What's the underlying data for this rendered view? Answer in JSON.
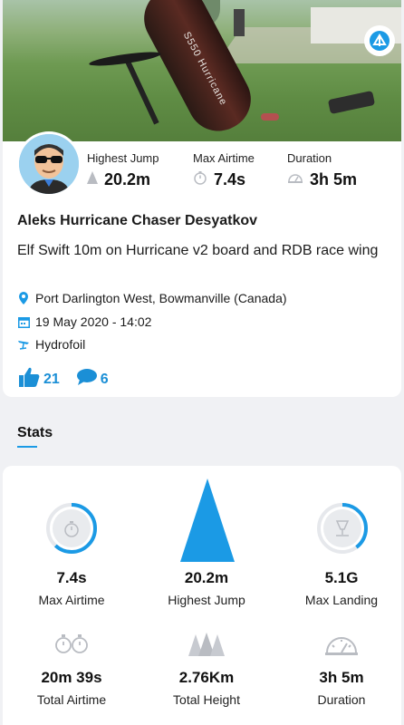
{
  "activity": {
    "rider_name": "Aleks Hurricane Chaser Desyatkov",
    "description": "Elf Swift 10m on Hurricane v2 board and RDB race wing",
    "location": "Port Darlington West, Bowmanville (Canada)",
    "datetime": "19 May 2020 - 14:02",
    "sport": "Hydrofoil",
    "likes": "21",
    "comments": "6",
    "board_print": "S550 Hurricane"
  },
  "top_stats": [
    {
      "label": "Highest Jump",
      "value": "20.2m",
      "icon": "mountain-peak-icon"
    },
    {
      "label": "Max Airtime",
      "value": "7.4s",
      "icon": "stopwatch-icon"
    },
    {
      "label": "Duration",
      "value": "3h 5m",
      "icon": "gauge-icon"
    }
  ],
  "stats_section": {
    "title": "Stats",
    "cells": [
      {
        "value": "7.4s",
        "label": "Max Airtime",
        "icon": "stopwatch-icon",
        "ring_fraction": 0.62
      },
      {
        "value": "20.2m",
        "label": "Highest Jump",
        "icon": "triangle-peak-icon"
      },
      {
        "value": "5.1G",
        "label": "Max Landing",
        "icon": "landing-icon",
        "ring_fraction": 0.4
      },
      {
        "value": "20m 39s",
        "label": "Total Airtime",
        "icon": "stopwatches-icon"
      },
      {
        "value": "2.76Km",
        "label": "Total Height",
        "icon": "mountains-icon"
      },
      {
        "value": "3h 5m",
        "label": "Duration",
        "icon": "gauge-icon"
      }
    ]
  },
  "colors": {
    "accent": "#1b9ae5",
    "ring_track": "#e6e8ec",
    "icon_gray": "#b9bcc2"
  }
}
